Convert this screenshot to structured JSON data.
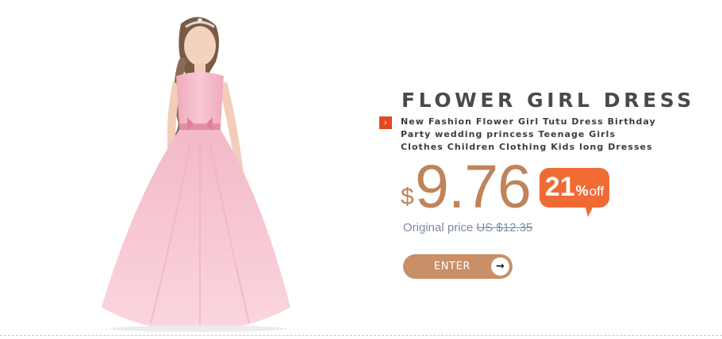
{
  "product": {
    "title": "FLOWER GIRL DRESS",
    "description_lines": [
      "New Fashion Flower Girl Tutu Dress Birthday",
      "Party wedding princess Teenage Girls",
      "Clothes Children Clothing Kids long Dresses"
    ],
    "bullet_icon": "chevron-right-icon"
  },
  "price": {
    "currency": "$",
    "value": "9.76",
    "original_label": "Original price",
    "original_value": "US $12.35"
  },
  "discount": {
    "number": "21",
    "percent": "%",
    "off": "off"
  },
  "cta": {
    "label": "ENTER",
    "icon": "arrow-right-icon"
  },
  "colors": {
    "accent": "#c0835a",
    "button": "#c98f67",
    "badge": "#f06a33",
    "bullet": "#e5481f",
    "dress": "#f6c6d2"
  }
}
